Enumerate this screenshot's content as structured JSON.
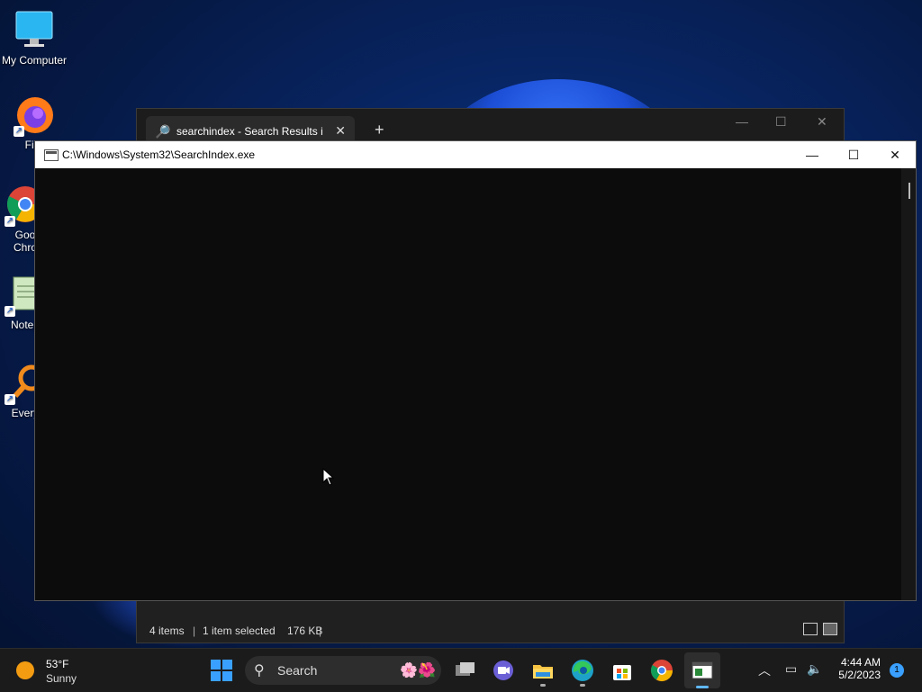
{
  "desktop": {
    "icons": [
      {
        "label": "My Computer"
      },
      {
        "label": "Fire"
      },
      {
        "label": "Goo\nChro"
      },
      {
        "label": "Notep"
      },
      {
        "label": "Every"
      }
    ]
  },
  "explorer": {
    "tab_label": "searchindex - Search Results i",
    "new_tab": "+",
    "status_items": "4 items",
    "status_selected": "1 item selected",
    "status_size": "176 KB"
  },
  "console": {
    "title": "C:\\Windows\\System32\\SearchIndex.exe"
  },
  "taskbar": {
    "weather_temp": "53°F",
    "weather_condition": "Sunny",
    "search_label": "Search",
    "time": "4:44 AM",
    "date": "5/2/2023",
    "notification_count": "1",
    "pinned": [
      "start-icon",
      "search-icon",
      "task-view-icon",
      "teams-chat-icon",
      "file-explorer-icon",
      "edge-icon",
      "microsoft-store-icon",
      "chrome-icon",
      "console-app-icon"
    ]
  },
  "colors": {
    "console_bg": "#0c0c0c",
    "taskbar_bg": "#1b1b1b",
    "accent": "#3aa0ff"
  }
}
